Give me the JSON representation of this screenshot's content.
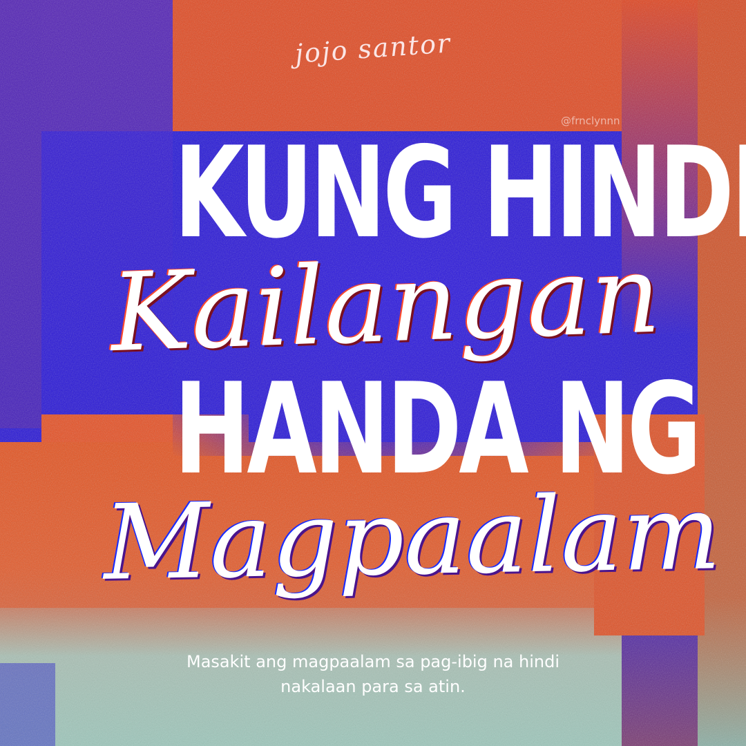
{
  "author": "jojo santor",
  "credit": "@frnclynnn",
  "headline": {
    "line1": "KUNG HINDI",
    "line2": "HANDA NG"
  },
  "script": {
    "word1": "Kailangan",
    "word2": "Magpaalam"
  },
  "caption": {
    "line1": "Masakit ang magpaalam sa pag-ibig na hindi",
    "line2": "nakalaan para sa atin."
  },
  "colors": {
    "blue": "#2316d8",
    "orange": "#e8461e",
    "teal": "#9fc3b7",
    "text": "#ffffff"
  }
}
